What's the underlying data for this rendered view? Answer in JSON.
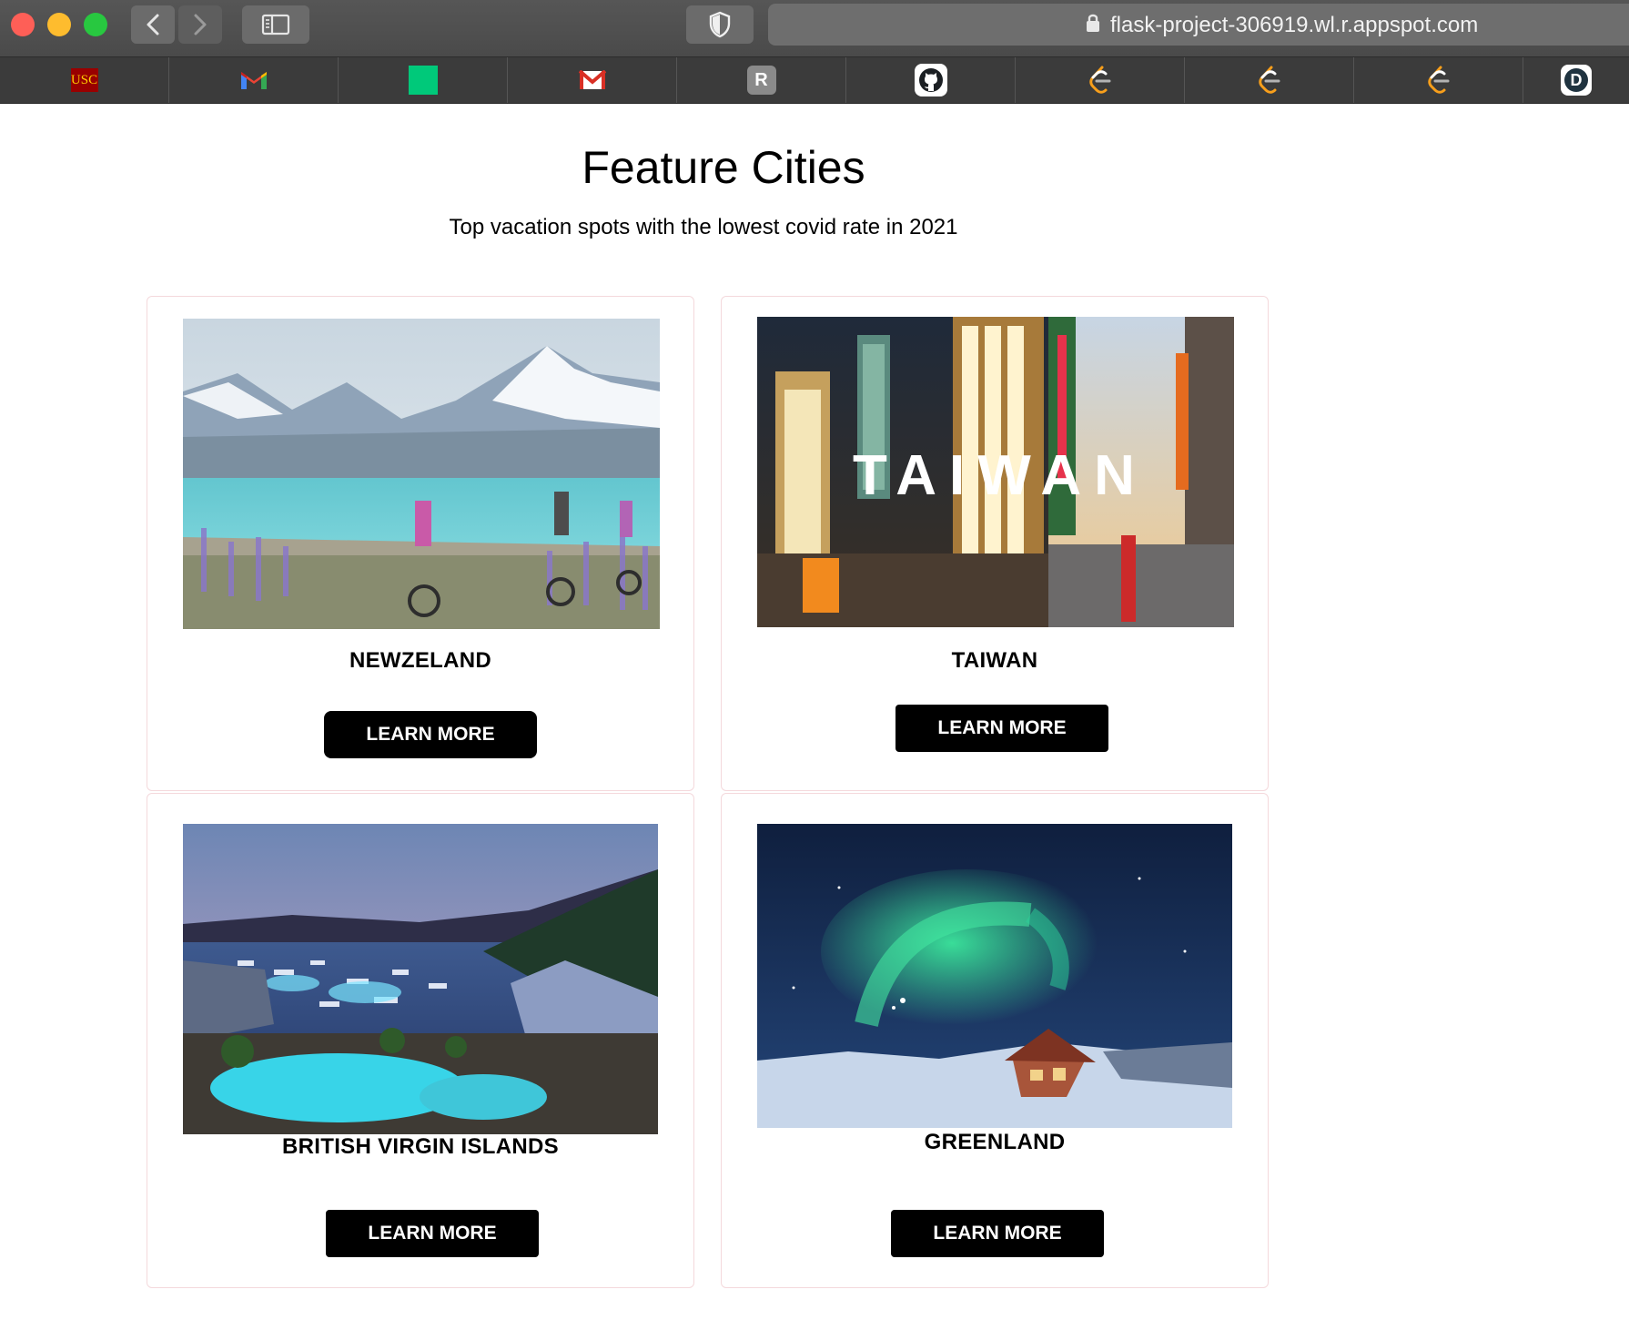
{
  "browser": {
    "url": "flask-project-306919.wl.r.appspot.com",
    "icons": {
      "close": "close-window-dot",
      "minimize": "minimize-window-dot",
      "zoom": "zoom-window-dot",
      "back": "chevron-left-icon",
      "forward": "chevron-right-icon",
      "sidebar": "sidebar-icon",
      "shield": "shield-icon",
      "lock": "lock-icon"
    }
  },
  "bookmarks": [
    {
      "name": "usc",
      "label": "USC",
      "color": "#990000"
    },
    {
      "name": "gmail",
      "icon": "gmail-icon"
    },
    {
      "name": "green-square",
      "icon": "green-square-icon",
      "color": "#00c97a"
    },
    {
      "name": "gmail-2",
      "icon": "gmail-envelope-icon"
    },
    {
      "name": "r",
      "label": "R"
    },
    {
      "name": "github",
      "icon": "github-icon"
    },
    {
      "name": "leetcode-1",
      "icon": "leetcode-icon",
      "color": "#f89f1b"
    },
    {
      "name": "leetcode-2",
      "icon": "leetcode-icon",
      "color": "#f89f1b"
    },
    {
      "name": "leetcode-3",
      "icon": "leetcode-icon",
      "color": "#f89f1b"
    },
    {
      "name": "d",
      "label": "D"
    }
  ],
  "page": {
    "title": "Feature Cities",
    "subtitle": "Top vacation spots with the lowest covid rate in 2021"
  },
  "cards": [
    {
      "title": "NEWZELAND",
      "button": "LEARN MORE",
      "image": "mountains-lake-cyclists-photo"
    },
    {
      "title": "TAIWAN",
      "button": "LEARN MORE",
      "image": "taipei-city-collage-photo",
      "overlay": "TAIWAN"
    },
    {
      "title": "BRITISH VIRGIN ISLANDS",
      "button": "LEARN MORE",
      "image": "marina-resort-pool-photo"
    },
    {
      "title": "GREENLAND",
      "button": "LEARN MORE",
      "image": "aurora-cabin-photo"
    }
  ]
}
